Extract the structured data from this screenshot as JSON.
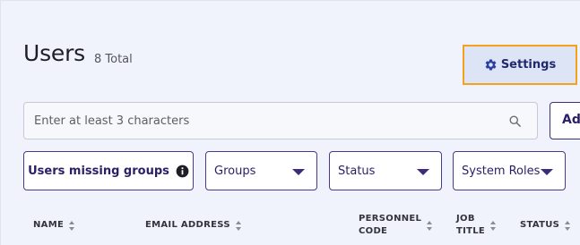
{
  "header": {
    "title": "Users",
    "count": "8 Total",
    "settings_label": "Settings"
  },
  "search": {
    "placeholder": "Enter at least 3 characters",
    "value": ""
  },
  "add_button": {
    "label": "Add"
  },
  "filters": {
    "missing_groups": "Users missing groups",
    "groups": "Groups",
    "status": "Status",
    "system_roles": "System Roles"
  },
  "table": {
    "columns": [
      {
        "label": "NAME"
      },
      {
        "label": "EMAIL ADDRESS"
      },
      {
        "label": "PERSONNEL\nCODE"
      },
      {
        "label": "JOB\nTITLE"
      },
      {
        "label": "STATUS"
      }
    ]
  },
  "colors": {
    "background": "#f0f3fb",
    "accent": "#2a1f66",
    "settings_border": "#f4a21e",
    "settings_background": "#dce4f6"
  },
  "icons": {
    "settings": "gear-icon",
    "search": "search-icon",
    "info": "info-icon",
    "sort": "sort-icon",
    "dropdown": "caret-down-icon"
  }
}
